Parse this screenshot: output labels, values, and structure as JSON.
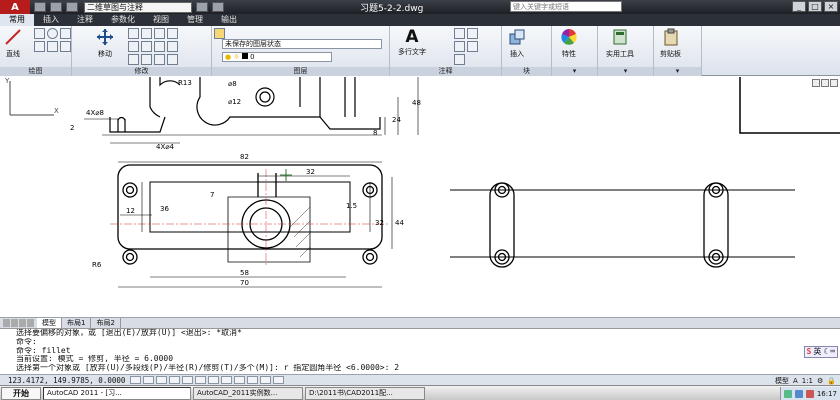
{
  "titlebar": {
    "logo_letter": "A",
    "workspace": "二维草图与注释",
    "file_title": "习题5-2-2.dwg",
    "search_placeholder": "键入关键字或短语"
  },
  "ribbon_tabs": [
    "常用",
    "插入",
    "注释",
    "参数化",
    "视图",
    "管理",
    "输出"
  ],
  "ribbon": {
    "draw": {
      "line_label": "直线",
      "panel": "绘图"
    },
    "modify": {
      "move_label": "移动",
      "panel": "修改"
    },
    "layers": {
      "state": "未保存的图层状态",
      "layer": "0",
      "panel": "图层"
    },
    "annotation": {
      "mtext_label": "多行文字",
      "panel": "注释"
    },
    "block": {
      "insert_label": "插入",
      "panel": "块"
    },
    "properties": {
      "label": "特性"
    },
    "utilities": {
      "label": "实用工具"
    },
    "clipboard": {
      "label": "剪贴板"
    }
  },
  "drawing": {
    "dims": {
      "d_82": "82",
      "d_32": "32",
      "d_58": "58",
      "d_70": "70",
      "d_12": "12",
      "d_36": "36",
      "d_7": "7",
      "d_1_5": "1.5",
      "d_32v": "32",
      "d_44": "44",
      "d_r6": "R6",
      "d_4x8": "4X⌀8",
      "d_4x4": "4X⌀4",
      "d_8": "⌀8",
      "d_12c": "⌀12",
      "d_r13": "R13",
      "d_48": "48",
      "d_8v": "8",
      "d_24": "24",
      "d_2": "2"
    }
  },
  "layout_tabs": [
    "模型",
    "布局1",
    "布局2"
  ],
  "command": {
    "lines": [
      "选择要偏移的对象，或 [退出(E)/放弃(U)] <退出>:  *取消*",
      "命令:",
      "命令:  fillet",
      "当前设置: 模式 = 修剪, 半径 = 6.0000",
      "选择第一个对象或 [放弃(U)/多段线(P)/半径(R)/修剪(T)/多个(M)]: r 指定圆角半径 <6.0000>: 2"
    ],
    "ime_label": "英"
  },
  "status": {
    "coords": "123.4172, 149.9785, 0.0000",
    "mode": "模型",
    "scale": "1:1",
    "ann_label": "A"
  },
  "taskbar": {
    "start": "开始",
    "tasks": [
      "AutoCAD 2011 - [习...",
      "AutoCAD_2011实例数...",
      "D:\\2011书\\CAD2011配..."
    ],
    "clock": "16:17"
  },
  "colors": {
    "accent_red": "#b71c1c",
    "ribbon_bg": "#dde3ec",
    "titlebar": "#2c3038"
  }
}
